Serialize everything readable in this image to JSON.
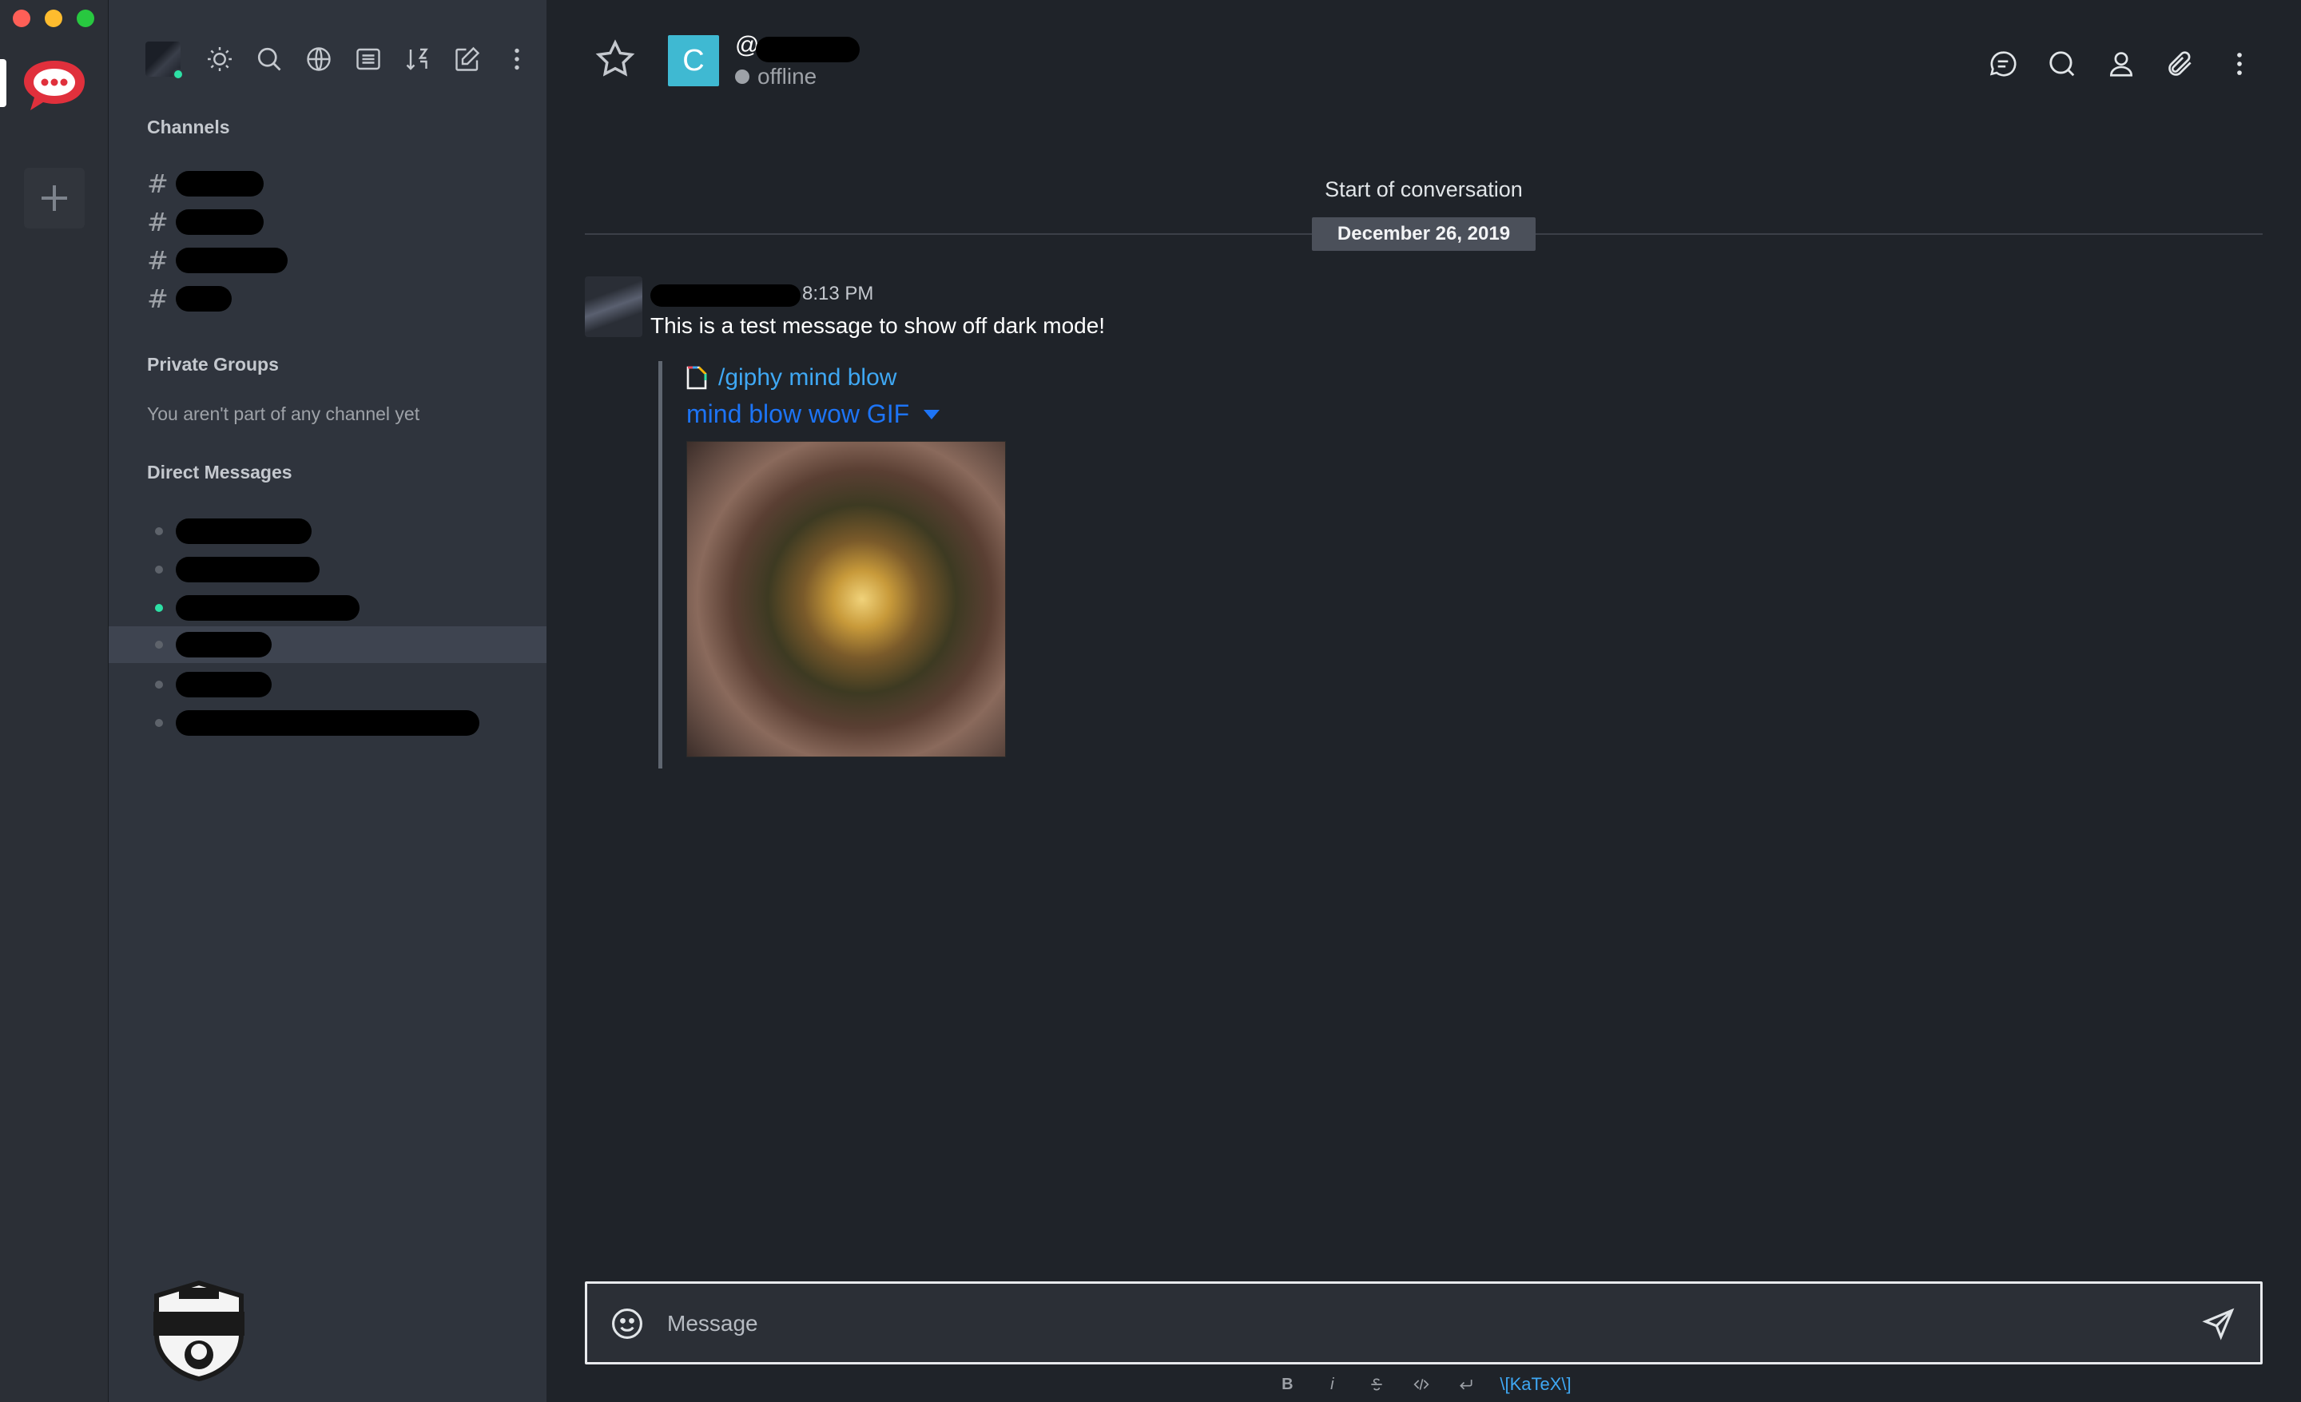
{
  "sidebar": {
    "toolbar_icons": [
      "home-icon",
      "sun-icon",
      "search-icon",
      "globe-icon",
      "list-icon",
      "sort-icon",
      "edit-icon",
      "kebab-icon"
    ],
    "channels_title": "Channels",
    "channels_count": 4,
    "private_groups_title": "Private Groups",
    "private_groups_empty": "You aren't part of any channel yet",
    "direct_messages_title": "Direct Messages",
    "direct_messages_count": 6,
    "direct_messages_active_index": 3
  },
  "header": {
    "room_initial": "C",
    "room_prefix": "@",
    "status": "offline",
    "actions": [
      "discussion-icon",
      "search-icon",
      "members-icon",
      "attachments-icon",
      "kebab-icon"
    ]
  },
  "conversation": {
    "start_label": "Start of conversation",
    "date": "December 26, 2019"
  },
  "message": {
    "time": "8:13 PM",
    "text": "This is a test message to show off dark mode!",
    "attachment": {
      "command": "/giphy mind blow",
      "title": "mind blow wow GIF"
    }
  },
  "composer": {
    "placeholder": "Message"
  },
  "format_toolbar": {
    "bold": "B",
    "italic": "i",
    "katex": "\\[KaTeX\\]"
  },
  "colors": {
    "accent": "#1d74f5",
    "link": "#3fa8f4",
    "online": "#2de0a5",
    "room_avatar": "#3fb9d2"
  }
}
